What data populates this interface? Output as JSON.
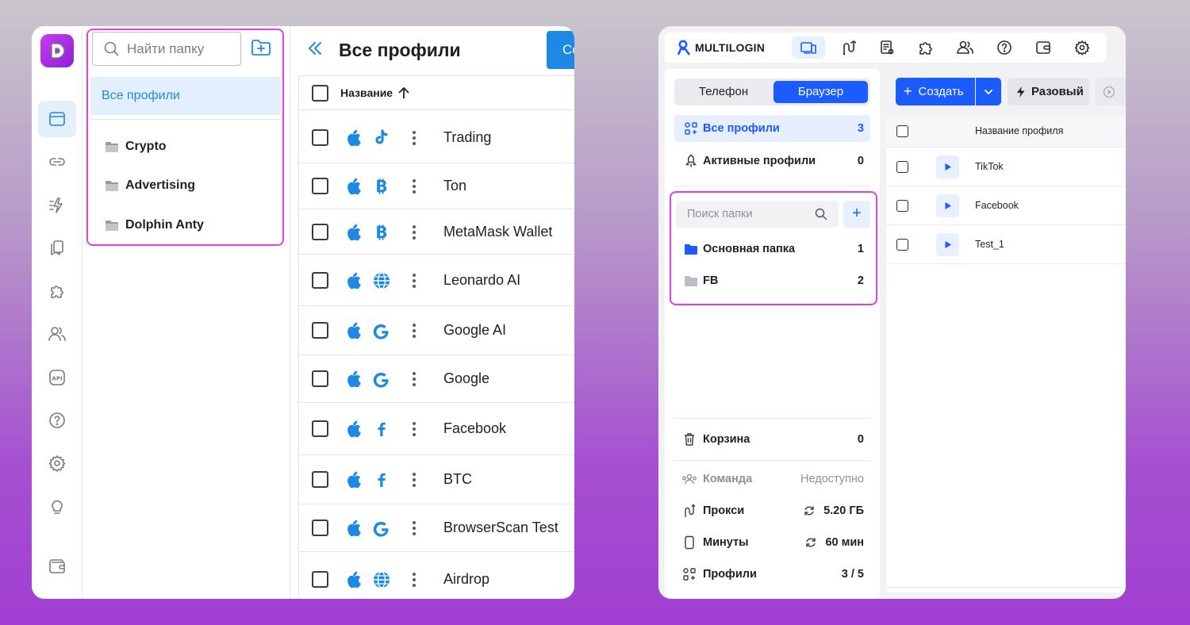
{
  "left_app": {
    "folders": {
      "search_placeholder": "Найти папку",
      "all_profiles": "Все профили",
      "items": [
        "Crypto",
        "Advertising",
        "Dolphin Anty"
      ]
    },
    "profiles": {
      "title": "Все профили",
      "create_label": "Со",
      "column_name": "Название",
      "rows": [
        {
          "name": "Trading",
          "site_icon": "tiktok-icon"
        },
        {
          "name": "Ton",
          "site_icon": "bitcoin-icon"
        },
        {
          "name": "MetaMask Wallet",
          "site_icon": "bitcoin-icon"
        },
        {
          "name": "Leonardo AI",
          "site_icon": "globe-icon"
        },
        {
          "name": "Google AI",
          "site_icon": "google-icon"
        },
        {
          "name": "Google",
          "site_icon": "google-icon"
        },
        {
          "name": "Facebook",
          "site_icon": "facebook-icon"
        },
        {
          "name": "BTC",
          "site_icon": "facebook-icon"
        },
        {
          "name": "BrowserScan Test",
          "site_icon": "google-icon"
        },
        {
          "name": "Airdrop",
          "site_icon": "globe-icon"
        }
      ]
    },
    "colors": {
      "accent": "#1e88e5",
      "highlight": "#e63ee6"
    }
  },
  "right_app": {
    "brand": "MULTILOGIN",
    "segment": {
      "phone": "Телефон",
      "browser": "Браузер"
    },
    "nav": {
      "all_profiles": {
        "label": "Все профили",
        "count": "3"
      },
      "active_profiles": {
        "label": "Активные профили",
        "count": "0"
      }
    },
    "folder_search_placeholder": "Поиск папки",
    "folders": [
      {
        "label": "Основная папка",
        "count": "1"
      },
      {
        "label": "FB",
        "count": "2"
      }
    ],
    "trash": {
      "label": "Корзина",
      "count": "0"
    },
    "stats": {
      "team": {
        "label": "Команда",
        "value": "Недоступно"
      },
      "proxy": {
        "label": "Прокси",
        "value": "5.20 ГБ"
      },
      "minutes": {
        "label": "Минуты",
        "value": "60 мин"
      },
      "profiles": {
        "label": "Профили",
        "value": "3 / 5"
      }
    },
    "toolbar": {
      "create": "Создать",
      "quick": "Разовый"
    },
    "table": {
      "column_name": "Название профиля",
      "rows": [
        "TikTok",
        "Facebook",
        "Test_1"
      ]
    },
    "colors": {
      "accent": "#1a5cff"
    }
  }
}
